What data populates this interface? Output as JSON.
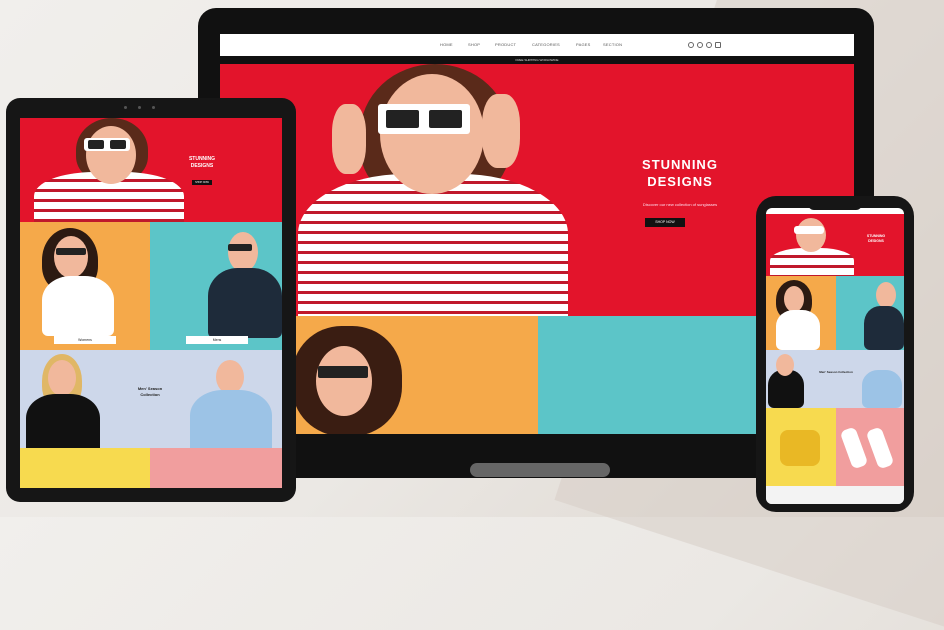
{
  "laptop": {
    "nav_items": [
      "HOME",
      "SHOP",
      "PRODUCT",
      "CATEGORIES",
      "PAGES",
      "SECTION"
    ],
    "topbar_text": "FREE SHIPPING WORLDWIDE",
    "hero": {
      "title_line1": "STUNNING",
      "title_line2": "DESIGNS",
      "subtitle": "Discover our new collection of sunglasses",
      "button": "SHOP NOW"
    }
  },
  "tablet": {
    "hero_title_line1": "STUNNING",
    "hero_title_line2": "DESIGNS",
    "hero_button": "SHOP NOW",
    "labels": [
      "Womens",
      "Mens"
    ],
    "collection_title_line1": "Men' Season",
    "collection_title_line2": "Collection"
  },
  "phone": {
    "hero_title_line1": "STUNNING",
    "hero_title_line2": "DESIGNS",
    "collection_title": "Men' Season Collection"
  },
  "colors": {
    "brand_red": "#e3142b",
    "orange": "#f5a94a",
    "teal": "#5cc5c8",
    "lavender": "#cdd7ea",
    "yellow": "#f7da4f",
    "pink": "#f19e9e"
  }
}
